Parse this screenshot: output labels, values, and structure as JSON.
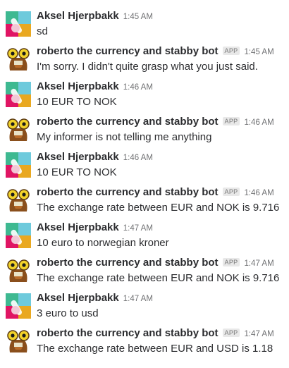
{
  "messages": [
    {
      "type": "user",
      "name": "Aksel Hjerpbakk",
      "time": "1:45 AM",
      "text": "sd"
    },
    {
      "type": "bot",
      "name": "roberto the currency and stabby bot",
      "badge": "APP",
      "time": "1:45 AM",
      "text": "I'm sorry. I didn't quite grasp what you just said."
    },
    {
      "type": "user",
      "name": "Aksel Hjerpbakk",
      "time": "1:46 AM",
      "text": "10 EUR TO NOK"
    },
    {
      "type": "bot",
      "name": "roberto the currency and stabby bot",
      "badge": "APP",
      "time": "1:46 AM",
      "text": "My informer is not telling me anything"
    },
    {
      "type": "user",
      "name": "Aksel Hjerpbakk",
      "time": "1:46 AM",
      "text": "10 EUR TO NOK"
    },
    {
      "type": "bot",
      "name": "roberto the currency and stabby bot",
      "badge": "APP",
      "time": "1:46 AM",
      "text": "The exchange rate between EUR and NOK is 9.716"
    },
    {
      "type": "user",
      "name": "Aksel Hjerpbakk",
      "time": "1:47 AM",
      "text": "10 euro to norwegian kroner"
    },
    {
      "type": "bot",
      "name": "roberto the currency and stabby bot",
      "badge": "APP",
      "time": "1:47 AM",
      "text": "The exchange rate between EUR and NOK is 9.716"
    },
    {
      "type": "user",
      "name": "Aksel Hjerpbakk",
      "time": "1:47 AM",
      "text": "3 euro to usd"
    },
    {
      "type": "bot",
      "name": "roberto the currency and stabby bot",
      "badge": "APP",
      "time": "1:47 AM",
      "text": "The exchange rate between EUR and USD is 1.18"
    }
  ]
}
